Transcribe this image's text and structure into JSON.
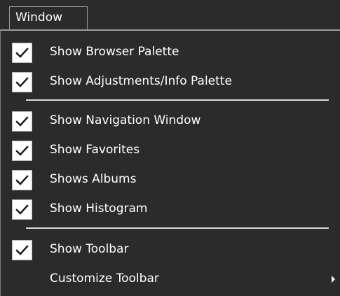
{
  "menu": {
    "title": "Window",
    "items": [
      {
        "label": "Show Browser Palette",
        "checked": true
      },
      {
        "label": "Show Adjustments/Info Palette",
        "checked": true
      },
      {
        "label": "Show Navigation Window",
        "checked": true
      },
      {
        "label": "Show Favorites",
        "checked": true
      },
      {
        "label": "Shows Albums",
        "checked": true
      },
      {
        "label": "Show Histogram",
        "checked": true
      },
      {
        "label": "Show Toolbar",
        "checked": true
      },
      {
        "label": "Customize Toolbar",
        "checked": false,
        "submenu": true
      }
    ]
  },
  "icons": {
    "check": "checkmark-icon",
    "submenu": "submenu-arrow-icon"
  },
  "colors": {
    "background": "#2b2b2b",
    "text": "#ffffff",
    "checkbox": "#ffffff",
    "separator": "#d8d8d8",
    "border": "#9a9a9a"
  }
}
